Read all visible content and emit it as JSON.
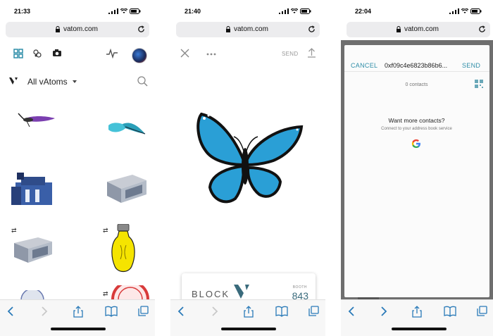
{
  "screens": [
    {
      "status": {
        "time": "21:33"
      },
      "browser": {
        "domain": "vatom.com"
      },
      "header": {
        "title": "All vAtoms"
      },
      "icons": [
        "grid-icon",
        "scan-icon",
        "camera-icon",
        "activity-icon",
        "avatar",
        "vatom-logo-icon",
        "search-icon"
      ],
      "grid": [
        "purple-dragonfly",
        "teal-butterfly",
        "blue-building",
        "building-booth",
        "building-booth-transfer",
        "yellow-lightbulb",
        "gear-medal",
        "red-seal"
      ]
    },
    {
      "status": {
        "time": "21:40"
      },
      "browser": {
        "domain": "vatom.com"
      },
      "actions": {
        "send_label": "SEND"
      },
      "card": {
        "brand": "BLOCK",
        "booth_label": "BOOTH",
        "booth_number": "843"
      }
    },
    {
      "status": {
        "time": "22:04"
      },
      "browser": {
        "domain": "vatom.com"
      },
      "modal": {
        "cancel_label": "CANCEL",
        "address": "0xf09c4e6823b86b6...",
        "send_label": "SEND",
        "contacts_count": "0 contacts",
        "want_more": "Want more contacts?",
        "connect_text": "Connect to your address book service"
      }
    }
  ],
  "colors": {
    "accent": "#2f8ea8",
    "butterfly_blue": "#2a9fd6",
    "bulb_yellow": "#f5e400",
    "booth_text": "#3a6b7c"
  }
}
